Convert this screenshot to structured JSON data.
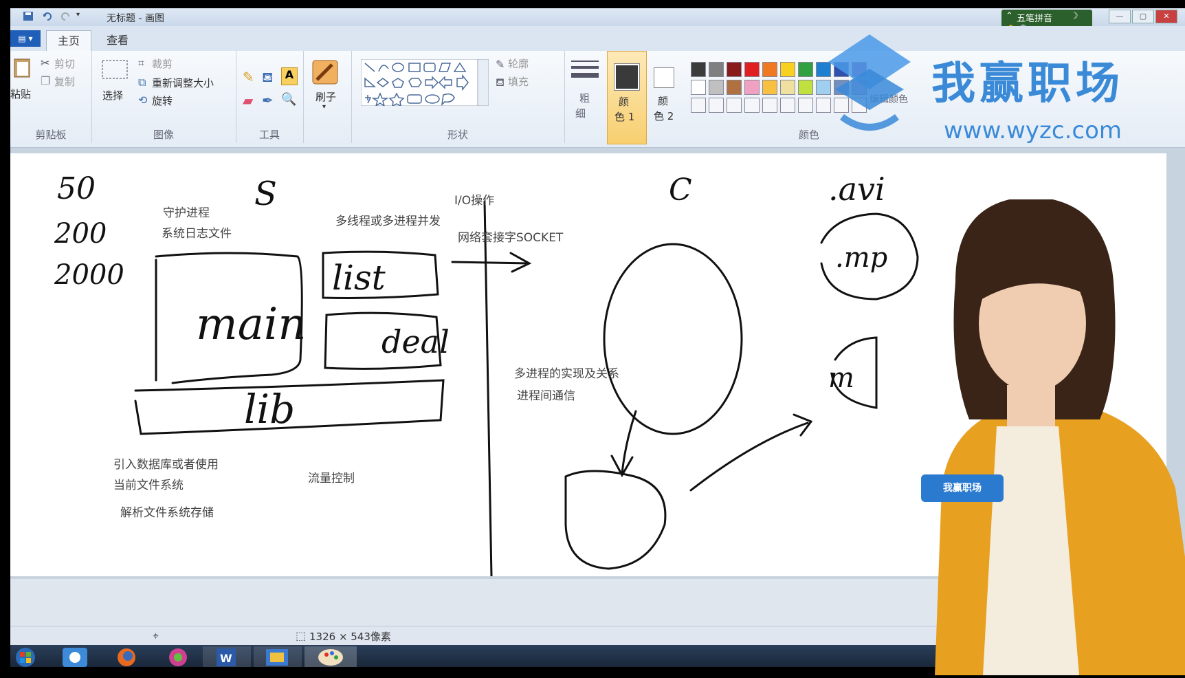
{
  "window": {
    "title": "无标题 - 画图",
    "ime_label": "五笔拼音",
    "ime_mode": "简"
  },
  "tabs": [
    {
      "label": "主页"
    },
    {
      "label": "查看"
    }
  ],
  "ribbon": {
    "clipboard": {
      "paste": "粘贴",
      "cut": "剪切",
      "copy": "复制",
      "label": "剪贴板"
    },
    "image": {
      "select": "选择",
      "crop": "裁剪",
      "resize": "重新调整大小",
      "rotate": "旋转",
      "label": "图像"
    },
    "tools": {
      "label": "工具",
      "text_glyph": "A"
    },
    "brush": {
      "label": "刷子"
    },
    "shapes": {
      "outline": "轮廓",
      "fill": "填充",
      "label": "形状"
    },
    "size": {
      "label1": "粗",
      "label2": "细"
    },
    "color1": {
      "label1": "颜",
      "label2": "色 1"
    },
    "color2": {
      "label1": "颜",
      "label2": "色 2"
    },
    "colors": {
      "label": "颜色",
      "edit": "编辑颜色"
    },
    "palette": [
      "#3b3b3b",
      "#7f7f7f",
      "#8a1b1b",
      "#e02020",
      "#f07820",
      "#f8d020",
      "#30a040",
      "#2080d0",
      "#3050b0",
      "#8040a0",
      "#ffffff",
      "#c0c0c0",
      "#b07040",
      "#f0a0c0",
      "#f8c040",
      "#f0e0a0",
      "#c0e040",
      "#a0d0f0",
      "#7090c0",
      "#c0a0d0"
    ]
  },
  "canvas_text": {
    "daemon": "守护进程",
    "syslog": "系统日志文件",
    "multithread": "多线程或多进程并发",
    "io": "I/O操作",
    "socket": "网络套接字SOCKET",
    "multiproc": "多进程的实现及关系",
    "ipc": "进程间通信",
    "database": "引入数据库或者使用",
    "filesystem": "当前文件系统",
    "parse": "解析文件系统存储",
    "flow": "流量控制"
  },
  "handwriting": {
    "s": "S",
    "c": "C",
    "main": "main",
    "list": "list",
    "deal": "deal",
    "lib": "lib",
    "avi": ".avi",
    "mp": ".mp",
    "m": "m",
    "n200": "200",
    "n2000": "2000",
    "n50": "50"
  },
  "status": {
    "dimensions": "1326 × 543像素"
  },
  "watermark": {
    "brand": "我赢职场",
    "url": "www.wyzc.com",
    "badge": "我赢职场"
  }
}
